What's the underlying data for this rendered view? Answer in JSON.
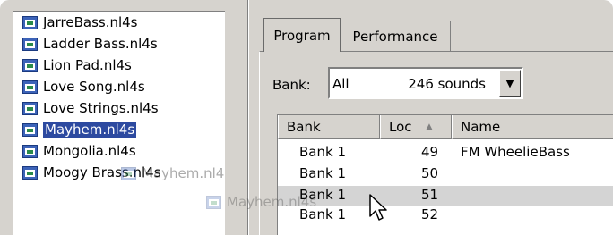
{
  "file_list": {
    "items": [
      {
        "name": "JarreBass.nl4s",
        "selected": false
      },
      {
        "name": "Ladder Bass.nl4s",
        "selected": false
      },
      {
        "name": "Lion Pad.nl4s",
        "selected": false
      },
      {
        "name": "Love Song.nl4s",
        "selected": false
      },
      {
        "name": "Love Strings.nl4s",
        "selected": false
      },
      {
        "name": "Mayhem.nl4s",
        "selected": true
      },
      {
        "name": "Mongolia.nl4s",
        "selected": false
      },
      {
        "name": "Moogy Brass.nl4s",
        "selected": false
      }
    ],
    "drag_ghost_1": "Mayhem.nl4s",
    "drag_ghost_2": "Mayhem.nl4s"
  },
  "tabs": [
    {
      "label": "Program",
      "active": true
    },
    {
      "label": "Performance",
      "active": false
    }
  ],
  "bank_selector": {
    "label": "Bank:",
    "value": "All",
    "count": "246 sounds",
    "dropdown_glyph": "▼"
  },
  "table": {
    "columns": [
      "Bank",
      "Loc",
      "Name"
    ],
    "sort_column": "Loc",
    "sort_glyph": "▲",
    "rows": [
      {
        "bank": "Bank 1",
        "loc": "49",
        "name": "FM WheelieBass"
      },
      {
        "bank": "Bank 1",
        "loc": "50",
        "name": ""
      },
      {
        "bank": "Bank 1",
        "loc": "51",
        "name": ""
      },
      {
        "bank": "Bank 1",
        "loc": "52",
        "name": ""
      }
    ],
    "drop_target_row": 2
  },
  "colors": {
    "window_bg": "#d6d3ce",
    "selection": "#2d4aa0",
    "drop_highlight": "#d4d4d4"
  }
}
